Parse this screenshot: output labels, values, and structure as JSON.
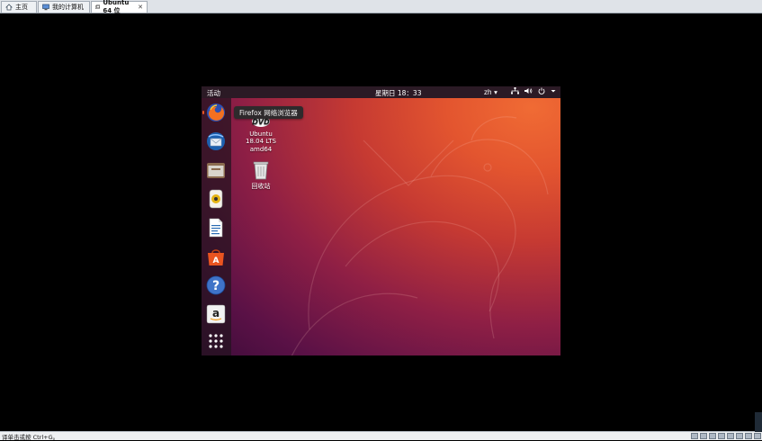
{
  "tabs": [
    {
      "label": "主页",
      "icon": "home-icon"
    },
    {
      "label": "我的计算机",
      "icon": "computer-icon"
    },
    {
      "label": "Ubuntu 64 位",
      "icon": "vm-icon",
      "active": true
    }
  ],
  "guest": {
    "topbar": {
      "activities": "活动",
      "clock": "星期日 18：33",
      "language": "zh ▾",
      "system_icons": [
        "network-icon",
        "volume-icon",
        "power-icon",
        "dropdown-arrow-icon"
      ]
    },
    "dock": {
      "items": [
        {
          "name": "firefox-icon"
        },
        {
          "name": "thunderbird-icon"
        },
        {
          "name": "files-icon"
        },
        {
          "name": "rhythmbox-icon"
        },
        {
          "name": "libreoffice-writer-icon"
        },
        {
          "name": "ubuntu-software-icon"
        },
        {
          "name": "help-icon"
        },
        {
          "name": "amazon-icon"
        },
        {
          "name": "show-applications-icon"
        }
      ]
    },
    "tooltip": "Firefox 网络浏览器",
    "desktop_icons": [
      {
        "name": "dvd-icon",
        "lines": [
          "Ubuntu",
          "18.04 LTS",
          "amd64"
        ]
      },
      {
        "name": "trash-icon",
        "lines": [
          "回收站"
        ]
      }
    ]
  },
  "status_bar": {
    "text": "要将输入定向到该虚拟机，请在虚拟机内部单击或按 Ctrl+G。",
    "visible_text": "译单击或按 Ctrl+G。"
  },
  "colors": {
    "accent": "#e95420",
    "topbar": "#2b1a25",
    "tab_bar": "#dfe3e8"
  }
}
